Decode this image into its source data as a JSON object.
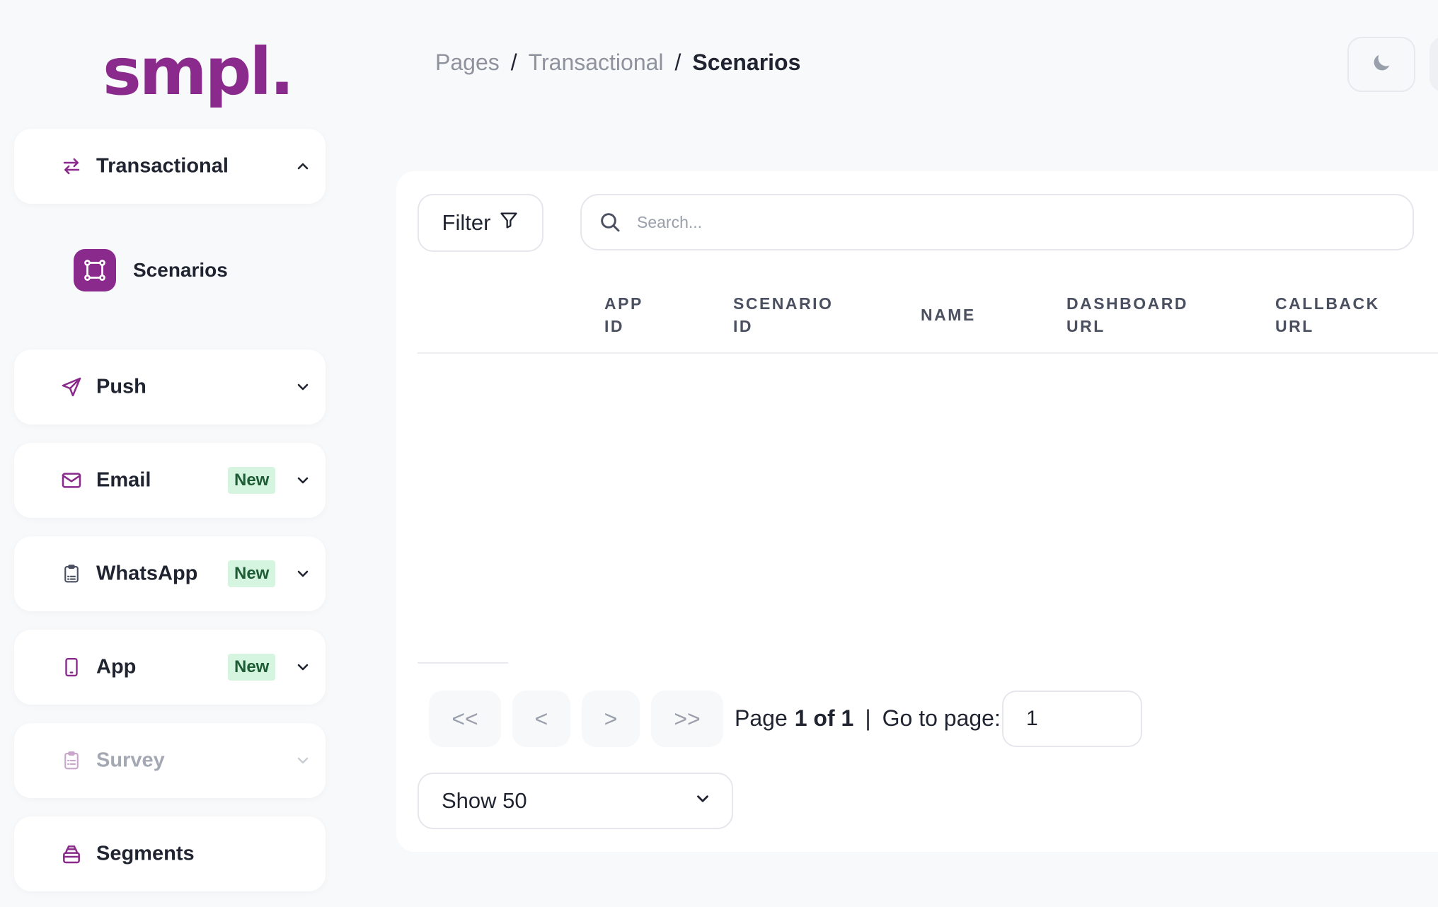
{
  "brand": {
    "logo_text": "smpl.",
    "color": "#8a2a8c"
  },
  "header": {
    "breadcrumb": [
      "Pages",
      "Transactional",
      "Scenarios"
    ],
    "theme_icon": "moon-icon"
  },
  "sidebar": {
    "transactional": {
      "label": "Transactional",
      "icon": "arrows-swap-icon",
      "expanded": true
    },
    "scenarios": {
      "label": "Scenarios",
      "icon": "frame-icon",
      "active": true
    },
    "push": {
      "label": "Push",
      "icon": "send-icon"
    },
    "email": {
      "label": "Email",
      "icon": "mail-icon",
      "badge": "New"
    },
    "whatsapp": {
      "label": "WhatsApp",
      "icon": "clipboard-icon",
      "badge": "New"
    },
    "app": {
      "label": "App",
      "icon": "phone-icon",
      "badge": "New"
    },
    "survey": {
      "label": "Survey",
      "icon": "clipboard-icon",
      "disabled": true
    },
    "segments": {
      "label": "Segments",
      "icon": "layers-icon"
    }
  },
  "toolbar": {
    "filter_label": "Filter",
    "search_placeholder": "Search..."
  },
  "table": {
    "columns": [
      {
        "line1": "APP",
        "line2": "ID"
      },
      {
        "line1": "SCENARIO",
        "line2": "ID"
      },
      {
        "line1": "NAME",
        "line2": ""
      },
      {
        "line1": "DASHBOARD",
        "line2": "URL"
      },
      {
        "line1": "CALLBACK",
        "line2": "URL"
      }
    ],
    "rows": []
  },
  "pagination": {
    "first": "<<",
    "prev": "<",
    "next": ">",
    "last": ">>",
    "page_word": "Page",
    "page_of": "1 of 1",
    "divider": "|",
    "goto_label": "Go to page:",
    "goto_value": "1",
    "show_label": "Show 50"
  },
  "colors": {
    "accent": "#8a2a8c",
    "badge_bg": "#d6f5e0",
    "badge_text": "#1e5c35",
    "background": "#f8f9fb"
  }
}
